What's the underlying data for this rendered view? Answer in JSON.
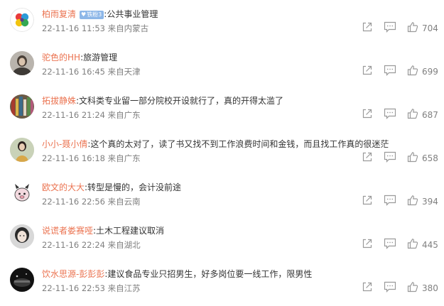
{
  "comments": [
    {
      "username": "柏雨复清",
      "badge": "铁粉3",
      "text": ":公共事业管理",
      "time": "22-11-16 11:53",
      "location": "来自内蒙古",
      "likes": "704"
    },
    {
      "username": "驼色的HH",
      "text": ":旅游管理",
      "time": "22-11-16 16:45",
      "location": "来自天津",
      "likes": "699"
    },
    {
      "username": "拓拔静姝",
      "text": ":文科类专业留一部分院校开设就行了，真的开得太滥了",
      "time": "22-11-16 21:24",
      "location": "来自广东",
      "likes": "687"
    },
    {
      "username": "小小-聂小倩",
      "text": ":这个真的太对了，读了书又找不到工作浪费时间和金钱，而且找工作真的很迷茫",
      "time": "22-11-16 16:18",
      "location": "来自广东",
      "likes": "658"
    },
    {
      "username": "欧文的大大",
      "text": ":转型是慢的，会计没前途",
      "time": "22-11-16 22:56",
      "location": "来自云南",
      "likes": "394"
    },
    {
      "username": "说谎者娄赛哑",
      "text": ":土木工程建议取消",
      "time": "22-11-16 22:24",
      "location": "来自湖北",
      "likes": "445"
    },
    {
      "username": "饮水思源-彭彭彭",
      "text": ":建议食品专业只招男生，好多岗位要一线工作，限男性",
      "time": "22-11-16 22:53",
      "location": "来自江苏",
      "likes": "380"
    }
  ]
}
